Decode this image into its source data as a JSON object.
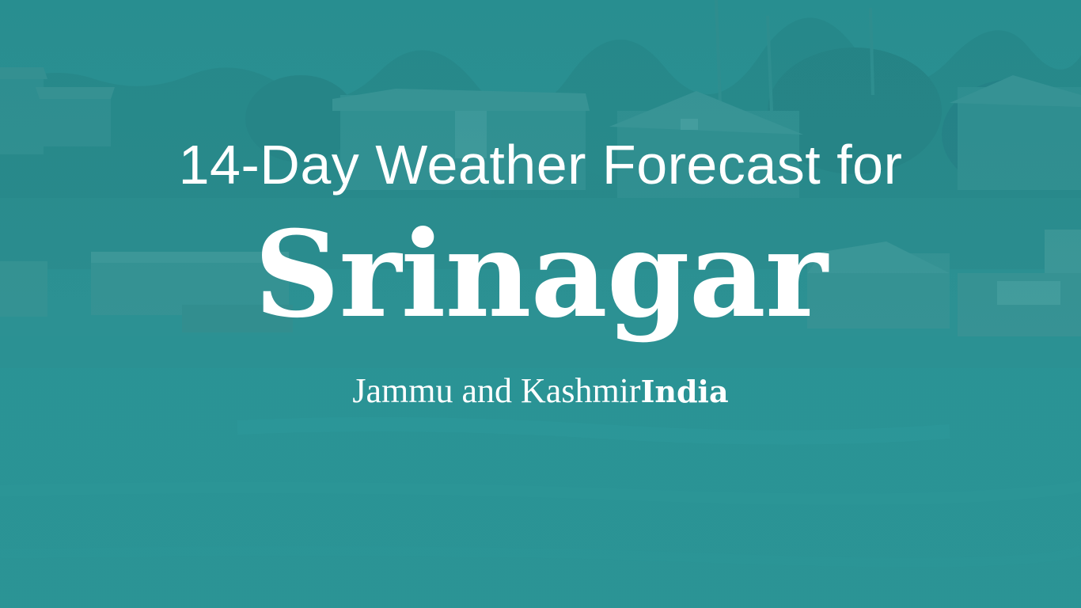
{
  "header": {
    "headline": "14-Day Weather Forecast for",
    "city": "Srinagar",
    "region": "Jammu and Kashmir",
    "country": "India"
  },
  "colors": {
    "overlay_teal": "#2b8e90",
    "text": "#ffffff"
  },
  "background": {
    "icon": "lake-houseboats-photo"
  }
}
